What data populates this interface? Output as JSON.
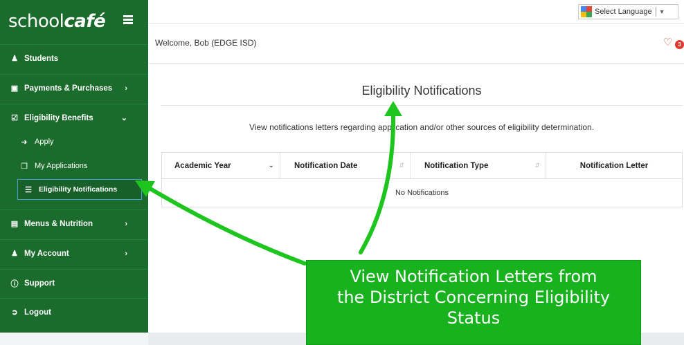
{
  "brand": {
    "logo_prefix": "school",
    "logo_suffix": "café"
  },
  "sidebar": {
    "items": [
      {
        "label": "Students",
        "icon": "users-icon"
      },
      {
        "label": "Payments & Purchases",
        "icon": "money-icon"
      },
      {
        "label": "Eligibility Benefits",
        "icon": "check-square-icon"
      },
      {
        "label": "Menus & Nutrition",
        "icon": "book-icon"
      },
      {
        "label": "My Account",
        "icon": "user-icon"
      },
      {
        "label": "Support",
        "icon": "info-icon"
      },
      {
        "label": "Logout",
        "icon": "sign-out-icon"
      }
    ],
    "subitems": [
      {
        "label": "Apply",
        "icon": "arrow-circle-icon"
      },
      {
        "label": "My Applications",
        "icon": "copy-icon"
      },
      {
        "label": "Eligibility Notifications",
        "icon": "list-icon"
      }
    ]
  },
  "topbar": {
    "language_label": "Select Language",
    "welcome": "Welcome, Bob (EDGE ISD)",
    "notification_count": "3"
  },
  "main": {
    "title": "Eligibility Notifications",
    "description": "View notifications letters regarding application and/or other sources of eligibility determination.",
    "table": {
      "headers": [
        "Academic Year",
        "Notification Date",
        "Notification Type",
        "Notification Letter"
      ],
      "empty_message": "No Notifications"
    }
  },
  "annotation": {
    "lines": [
      "View Notification Letters from",
      "the District Concerning Eligibility",
      "Status"
    ]
  },
  "colors": {
    "sidebar": "#1b6b2c",
    "callout": "#17b21e",
    "badge": "#e03a2f"
  }
}
